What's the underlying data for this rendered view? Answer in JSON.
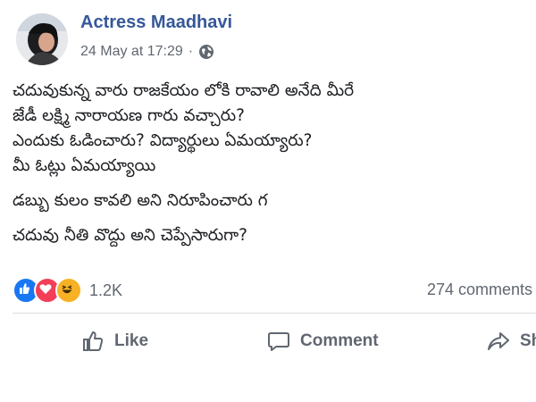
{
  "post": {
    "author": "Actress Maadhavi",
    "timestamp": "24 May at 17:29",
    "separator": "·",
    "privacy_icon": "globe-icon",
    "lines": [
      "చదువుకున్న వారు రాజకేయం లోకి రావాలి అనేది మీరే",
      "జేడీ లక్ష్మి నారాయణ గారు వచ్చారు?",
      "ఎందుకు ఓడించారు? విద్యార్థులు ఏమయ్యారు?",
      "మీ ఓట్లు ఏమయ్యాయి",
      "డబ్బు కులం కావలి అని నిరూపించారు గ",
      "చదువు నీతి వొద్దు అని చెప్పేసారుగా?"
    ]
  },
  "reactions": {
    "icons": [
      "like-reaction-icon",
      "love-reaction-icon",
      "haha-reaction-icon"
    ],
    "count": "1.2K"
  },
  "comments": {
    "count_label": "274 comments"
  },
  "actions": {
    "like_label": "Like",
    "comment_label": "Comment",
    "share_label": "Sh"
  },
  "colors": {
    "author": "#365899",
    "meta": "#616770",
    "like_reaction": "#1877f2",
    "love_reaction": "#f33e58",
    "haha_reaction": "#f7b125"
  }
}
